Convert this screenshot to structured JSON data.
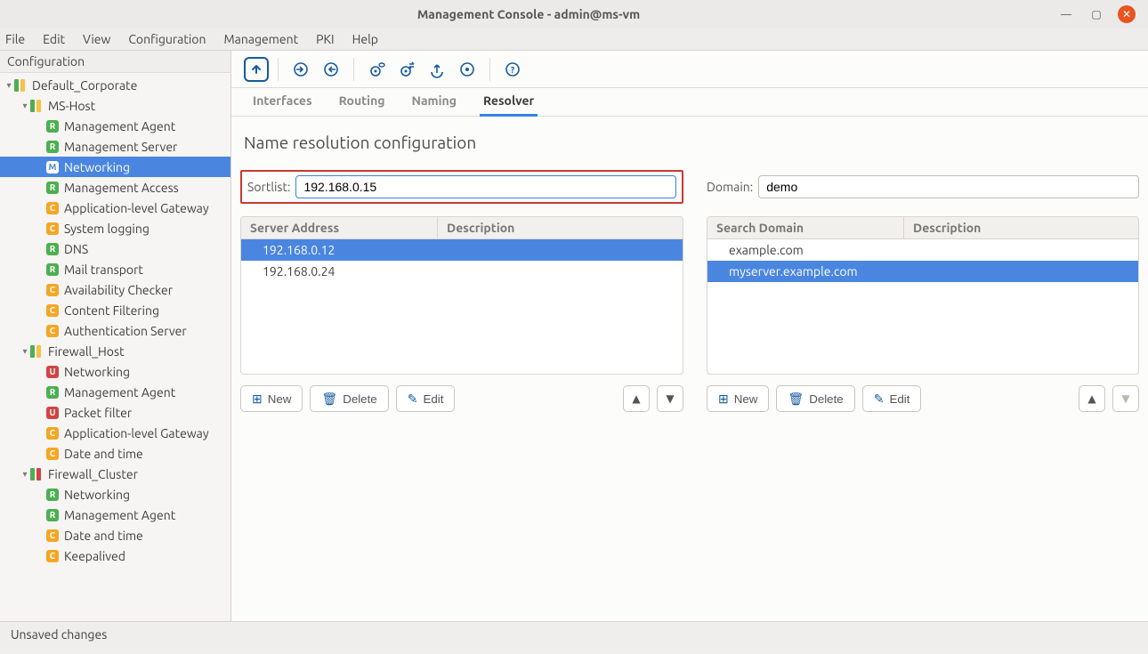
{
  "window": {
    "title": "Management Console - admin@ms-vm"
  },
  "menubar": [
    "File",
    "Edit",
    "View",
    "Configuration",
    "Management",
    "PKI",
    "Help"
  ],
  "sidebar": {
    "heading": "Configuration",
    "tree": {
      "name": "Default_Corporate",
      "hosts": [
        {
          "name": "MS-Host",
          "items": [
            {
              "tag": "R",
              "name": "Management Agent"
            },
            {
              "tag": "R",
              "name": "Management Server"
            },
            {
              "tag": "M",
              "name": "Networking",
              "selected": true
            },
            {
              "tag": "R",
              "name": "Management Access"
            },
            {
              "tag": "C",
              "name": "Application-level Gateway"
            },
            {
              "tag": "C",
              "name": "System logging"
            },
            {
              "tag": "R",
              "name": "DNS"
            },
            {
              "tag": "R",
              "name": "Mail transport"
            },
            {
              "tag": "C",
              "name": "Availability Checker"
            },
            {
              "tag": "C",
              "name": "Content Filtering"
            },
            {
              "tag": "C",
              "name": "Authentication Server"
            }
          ]
        },
        {
          "name": "Firewall_Host",
          "items": [
            {
              "tag": "U",
              "name": "Networking"
            },
            {
              "tag": "R",
              "name": "Management Agent"
            },
            {
              "tag": "U",
              "name": "Packet filter"
            },
            {
              "tag": "C",
              "name": "Application-level Gateway"
            },
            {
              "tag": "C",
              "name": "Date and time"
            }
          ]
        },
        {
          "name": "Firewall_Cluster",
          "bars": "gr",
          "items": [
            {
              "tag": "R",
              "name": "Networking"
            },
            {
              "tag": "R",
              "name": "Management Agent"
            },
            {
              "tag": "C",
              "name": "Date and time"
            },
            {
              "tag": "C",
              "name": "Keepalived"
            }
          ]
        }
      ]
    }
  },
  "tabs": {
    "list": [
      "Interfaces",
      "Routing",
      "Naming",
      "Resolver"
    ],
    "active": 3
  },
  "page": {
    "heading": "Name resolution configuration",
    "sortlist_label": "Sortlist:",
    "sortlist_value": "192.168.0.15",
    "domain_label": "Domain:",
    "domain_value": "demo",
    "servers": {
      "headers": [
        "Server Address",
        "Description"
      ],
      "rows": [
        {
          "addr": "192.168.0.12",
          "desc": "",
          "sel": true
        },
        {
          "addr": "192.168.0.24",
          "desc": ""
        }
      ]
    },
    "search": {
      "headers": [
        "Search Domain",
        "Description"
      ],
      "rows": [
        {
          "name": "example.com",
          "desc": ""
        },
        {
          "name": "myserver.example.com",
          "desc": "",
          "sel": true
        }
      ]
    },
    "buttons": {
      "new": "New",
      "delete": "Delete",
      "edit": "Edit"
    }
  },
  "status": "Unsaved changes",
  "colors": {
    "accent": "#165a9c",
    "selection": "#4a86e0",
    "close": "#e95420"
  }
}
